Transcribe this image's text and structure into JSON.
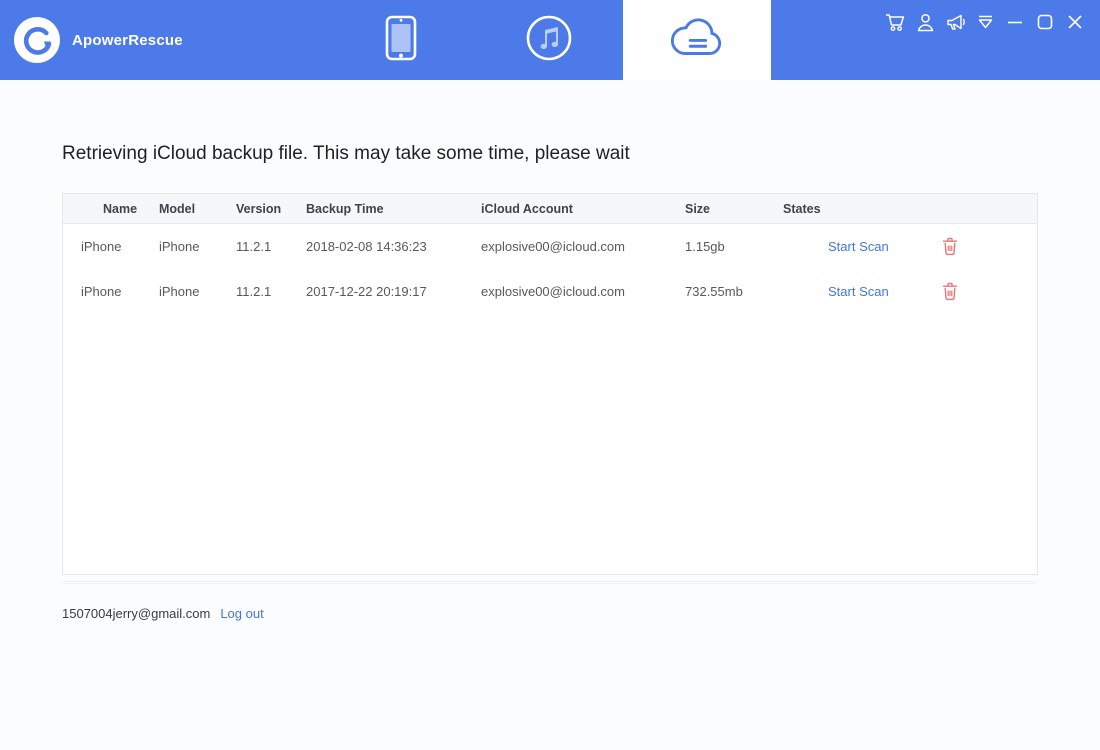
{
  "app": {
    "name": "ApowerRescue"
  },
  "titlebar": {
    "tabs": [
      {
        "id": "phone",
        "icon": "phone-icon",
        "active": false
      },
      {
        "id": "itunes",
        "icon": "itunes-icon",
        "active": false
      },
      {
        "id": "icloud",
        "icon": "icloud-icon",
        "active": true
      }
    ],
    "window_icons": [
      "cart-icon",
      "account-icon",
      "megaphone-icon",
      "dropdown-icon",
      "minimize-icon",
      "maximize-icon",
      "close-icon"
    ]
  },
  "main": {
    "heading": "Retrieving iCloud backup file. This may take some time, please wait",
    "table": {
      "columns": [
        "Name",
        "Model",
        "Version",
        "Backup Time",
        "iCloud Account",
        "Size",
        "States"
      ],
      "rows": [
        {
          "name": "iPhone",
          "model": "iPhone",
          "version": "11.2.1",
          "backup_time": "2018-02-08 14:36:23",
          "icloud_account": "explosive00@icloud.com",
          "size": "1.15gb",
          "action": "Start Scan"
        },
        {
          "name": "iPhone",
          "model": "iPhone",
          "version": "11.2.1",
          "backup_time": "2017-12-22 20:19:17",
          "icloud_account": "explosive00@icloud.com",
          "size": "732.55mb",
          "action": "Start Scan"
        }
      ]
    },
    "footer": {
      "account": "1507004jerry@gmail.com",
      "logout_label": "Log out"
    }
  },
  "colors": {
    "header_blue": "#4c7be9",
    "link_blue": "#4076e4",
    "trash_red": "#e87474"
  }
}
